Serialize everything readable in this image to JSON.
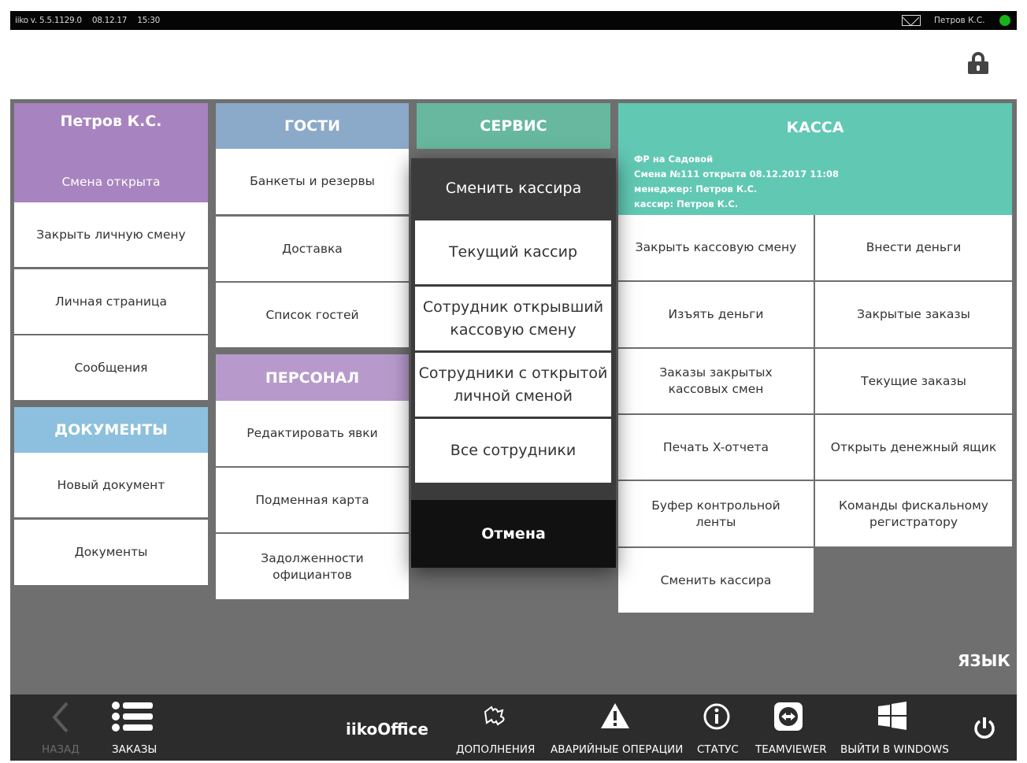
{
  "topbar": {
    "version": "iiko v. 5.5.1129.0",
    "date": "08.12.17",
    "time": "15:30",
    "user": "Петров К.С."
  },
  "colors": {
    "user_header": "#a783bf",
    "guests_header": "#8ba9c8",
    "service_header": "#67b89e",
    "staff_header": "#b79acb",
    "docs_header": "#8cc0de",
    "kassa_header": "#61c8b3",
    "status_dot": "#19b319"
  },
  "user": {
    "name": "Петров К.С.",
    "shift": "Смена открыта",
    "items": [
      "Закрыть личную смену",
      "Личная страница",
      "Сообщения"
    ]
  },
  "documents": {
    "header": "ДОКУМЕНТЫ",
    "items": [
      "Новый документ",
      "Документы"
    ]
  },
  "guests": {
    "header": "ГОСТИ",
    "items": [
      "Банкеты и резервы",
      "Доставка",
      "Список гостей"
    ]
  },
  "staff": {
    "header": "ПЕРСОНАЛ",
    "items": [
      "Редактировать явки",
      "Подменная карта",
      "Задолженности официантов"
    ]
  },
  "service": {
    "header": "СЕРВИС"
  },
  "kassa": {
    "header": "КАССА",
    "info": [
      "ФР на Садовой",
      "Смена №111 открыта 08.12.2017 11:08",
      "менеджер: Петров К.С.",
      "кассир: Петров К.С."
    ],
    "items": [
      "Закрыть кассовую смену",
      "Внести деньги",
      "Изъять деньги",
      "Закрытые заказы",
      "Заказы закрытых кассовых смен",
      "Текущие заказы",
      "Печать X-отчета",
      "Открыть денежный ящик",
      "Буфер контрольной ленты",
      "Команды фискальному регистратору",
      "Сменить кассира"
    ]
  },
  "dialog": {
    "title": "Сменить кассира",
    "options": [
      "Текущий кассир",
      "Сотрудник открывший кассовую смену",
      "Сотрудники с открытой личной сменой",
      "Все сотрудники"
    ],
    "cancel": "Отмена"
  },
  "language": "ЯЗЫК",
  "bottom": {
    "back": "НАЗАД",
    "orders": "ЗАКАЗЫ",
    "app": "iikoOffice",
    "addons": "ДОПОЛНЕНИЯ",
    "emergency": "АВАРИЙНЫЕ ОПЕРАЦИИ",
    "status": "СТАТУС",
    "teamviewer": "TEAMVIEWER",
    "exit_windows": "ВЫЙТИ В WINDOWS"
  }
}
